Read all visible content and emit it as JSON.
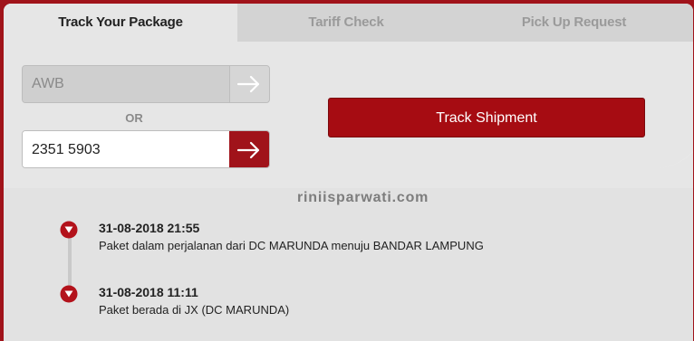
{
  "tabs": [
    {
      "label": "Track Your Package",
      "active": true
    },
    {
      "label": "Tariff Check",
      "active": false
    },
    {
      "label": "Pick Up Request",
      "active": false
    }
  ],
  "form": {
    "awb_placeholder": "AWB",
    "or_label": "OR",
    "number_value": "2351 5903",
    "track_button": "Track Shipment"
  },
  "watermark": "riniisparwati.com",
  "events": [
    {
      "date": "31-08-2018 21:55",
      "description": "Paket dalam perjalanan dari DC MARUNDA menuju BANDAR LAMPUNG"
    },
    {
      "date": "31-08-2018 11:11",
      "description": "Paket berada di JX (DC MARUNDA)"
    }
  ],
  "icons": {
    "arrow": "arrow-right-icon",
    "marker": "location-pin-icon"
  },
  "colors": {
    "brand_red": "#a60c12",
    "background": "#e6e6e6"
  }
}
